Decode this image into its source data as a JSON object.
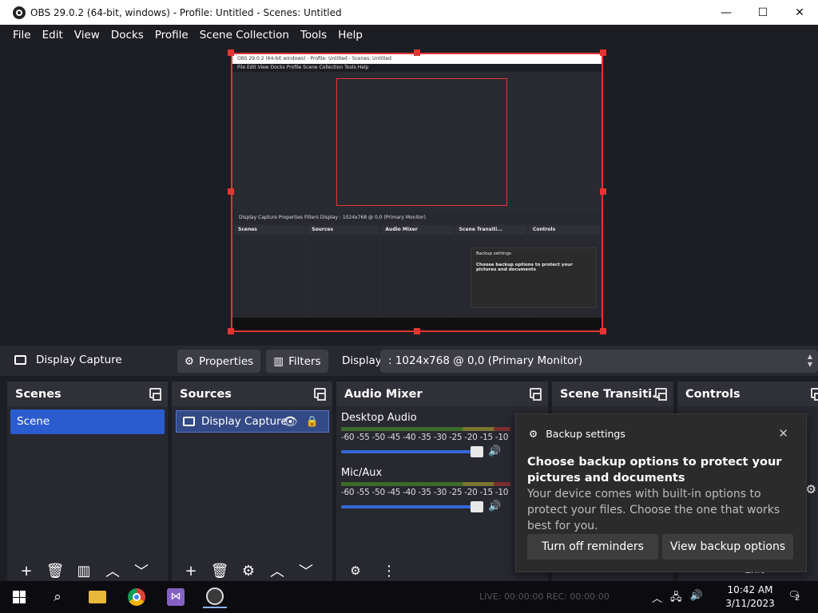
{
  "window": {
    "title": "OBS 29.0.2 (64-bit, windows) - Profile: Untitled - Scenes: Untitled",
    "minimize": "—",
    "maximize": "☐",
    "close": "✕"
  },
  "menu": {
    "items": [
      "File",
      "Edit",
      "View",
      "Docks",
      "Profile",
      "Scene Collection",
      "Tools",
      "Help"
    ]
  },
  "preview": {
    "mini_title": "OBS 29.0.2 (64-bit windows) - Profile: Untitled - Scenes: Untitled",
    "mini_menu": "File  Edit  View  Docks  Profile  Scene Collection  Tools  Help",
    "mini_bar": "Display Capture     Properties   Filters    Display   : 1024x768 @ 0,0 (Primary Monitor)",
    "mini_docks": [
      "Scenes",
      "Sources",
      "Audio Mixer",
      "Scene Transiti...",
      "Controls"
    ],
    "mini_toast_title": "Backup settings",
    "mini_toast_body": "Choose backup options to protect your pictures and documents"
  },
  "source_toolbar": {
    "source_name": "Display Capture",
    "properties_label": "Properties",
    "filters_label": "Filters",
    "display_label": "Display",
    "display_value": ": 1024x768 @ 0,0 (Primary Monitor)"
  },
  "docks": {
    "scenes": {
      "title": "Scenes",
      "items": [
        "Scene"
      ]
    },
    "sources": {
      "title": "Sources",
      "items": [
        "Display Capture"
      ]
    },
    "audio_mixer": {
      "title": "Audio Mixer",
      "channels": [
        {
          "name": "Desktop Audio",
          "ticks": "-60 -55 -50 -45 -40 -35 -30 -25 -20 -15 -10"
        },
        {
          "name": "Mic/Aux",
          "ticks": "-60 -55 -50 -45 -40 -35 -30 -25 -20 -15 -10"
        }
      ]
    },
    "transitions": {
      "title": "Scene Transiti..."
    },
    "controls": {
      "title": "Controls",
      "exit_label": "Exit"
    }
  },
  "toast": {
    "header": "Backup settings",
    "title": "Choose backup options to protect your pictures and documents",
    "body": "Your device comes with built-in options to protect your files. Choose the one that works best for you.",
    "btn_turn_off": "Turn off reminders",
    "btn_view": "View backup options"
  },
  "taskbar": {
    "status": "LIVE: 00:00:00     REC: 00:00:00",
    "time": "10:42 AM",
    "date": "3/11/2023",
    "notifications": "2"
  }
}
